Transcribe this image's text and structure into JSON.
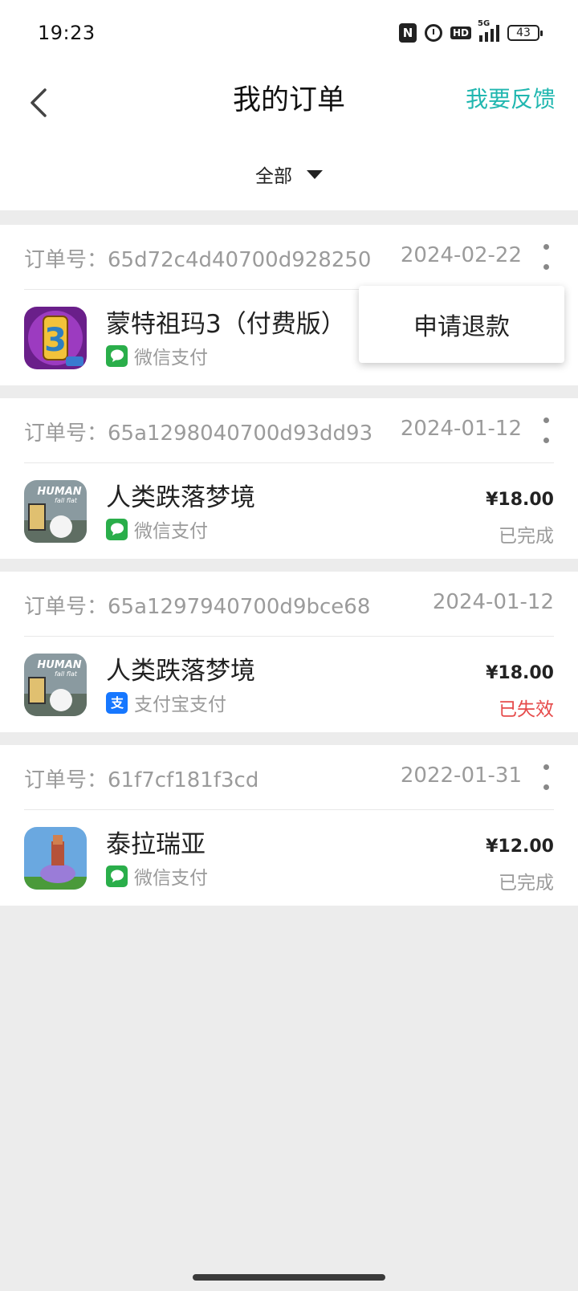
{
  "status_bar": {
    "time": "19:23",
    "battery": "43",
    "network": "5G",
    "hd": "HD",
    "nfc": "N"
  },
  "header": {
    "title": "我的订单",
    "feedback": "我要反馈"
  },
  "filter": {
    "selected": "全部"
  },
  "popup": {
    "refund": "申请退款"
  },
  "orders": [
    {
      "order_no": "订单号：65d72c4d40700d928250",
      "date": "2024-02-22",
      "name": "蒙特祖玛3（付费版）",
      "payment": "微信支付",
      "price": "",
      "status": ""
    },
    {
      "order_no": "订单号：65a1298040700d93dd93",
      "date": "2024-01-12",
      "name": "人类跌落梦境",
      "payment": "微信支付",
      "price": "¥18.00",
      "status": "已完成"
    },
    {
      "order_no": "订单号：65a1297940700d9bce68",
      "date": "2024-01-12",
      "name": "人类跌落梦境",
      "payment": "支付宝支付",
      "price": "¥18.00",
      "status": "已失效"
    },
    {
      "order_no": "订单号：61f7cf181f3cd",
      "date": "2022-01-31",
      "name": "泰拉瑞亚",
      "payment": "微信支付",
      "price": "¥12.00",
      "status": "已完成"
    }
  ],
  "game_icon_text": {
    "montezuma_number": "3",
    "human_title": "HUMAN",
    "human_sub": "fall flat"
  },
  "colors": {
    "accent": "#21b7b0",
    "wechat": "#2aae4a",
    "alipay": "#1677ff",
    "invalid": "#e64b4b"
  }
}
